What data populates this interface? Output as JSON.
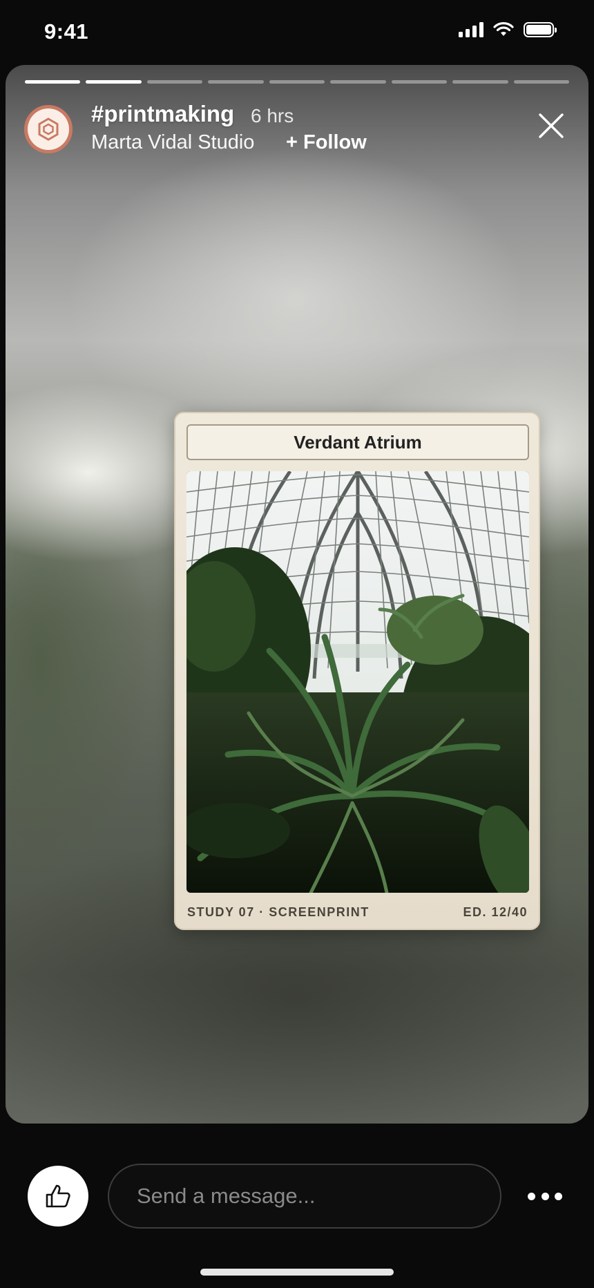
{
  "status_bar": {
    "time": "9:41"
  },
  "story": {
    "progress": {
      "total_segments": 9,
      "completed_segments": 2
    },
    "hashtag": "#printmaking",
    "time_ago": "6 hrs",
    "author": "Marta Vidal Studio",
    "follow_label": "+ Follow"
  },
  "print_card": {
    "title": "Verdant Atrium",
    "meta_left": "STUDY 07 · SCREENPRINT",
    "meta_right": "ED. 12/40"
  },
  "bottom_bar": {
    "message_placeholder": "Send a message..."
  },
  "colors": {
    "avatar_accent": "#c97a63",
    "card_background": "#efe9dc",
    "app_background": "#0a0a0a"
  }
}
